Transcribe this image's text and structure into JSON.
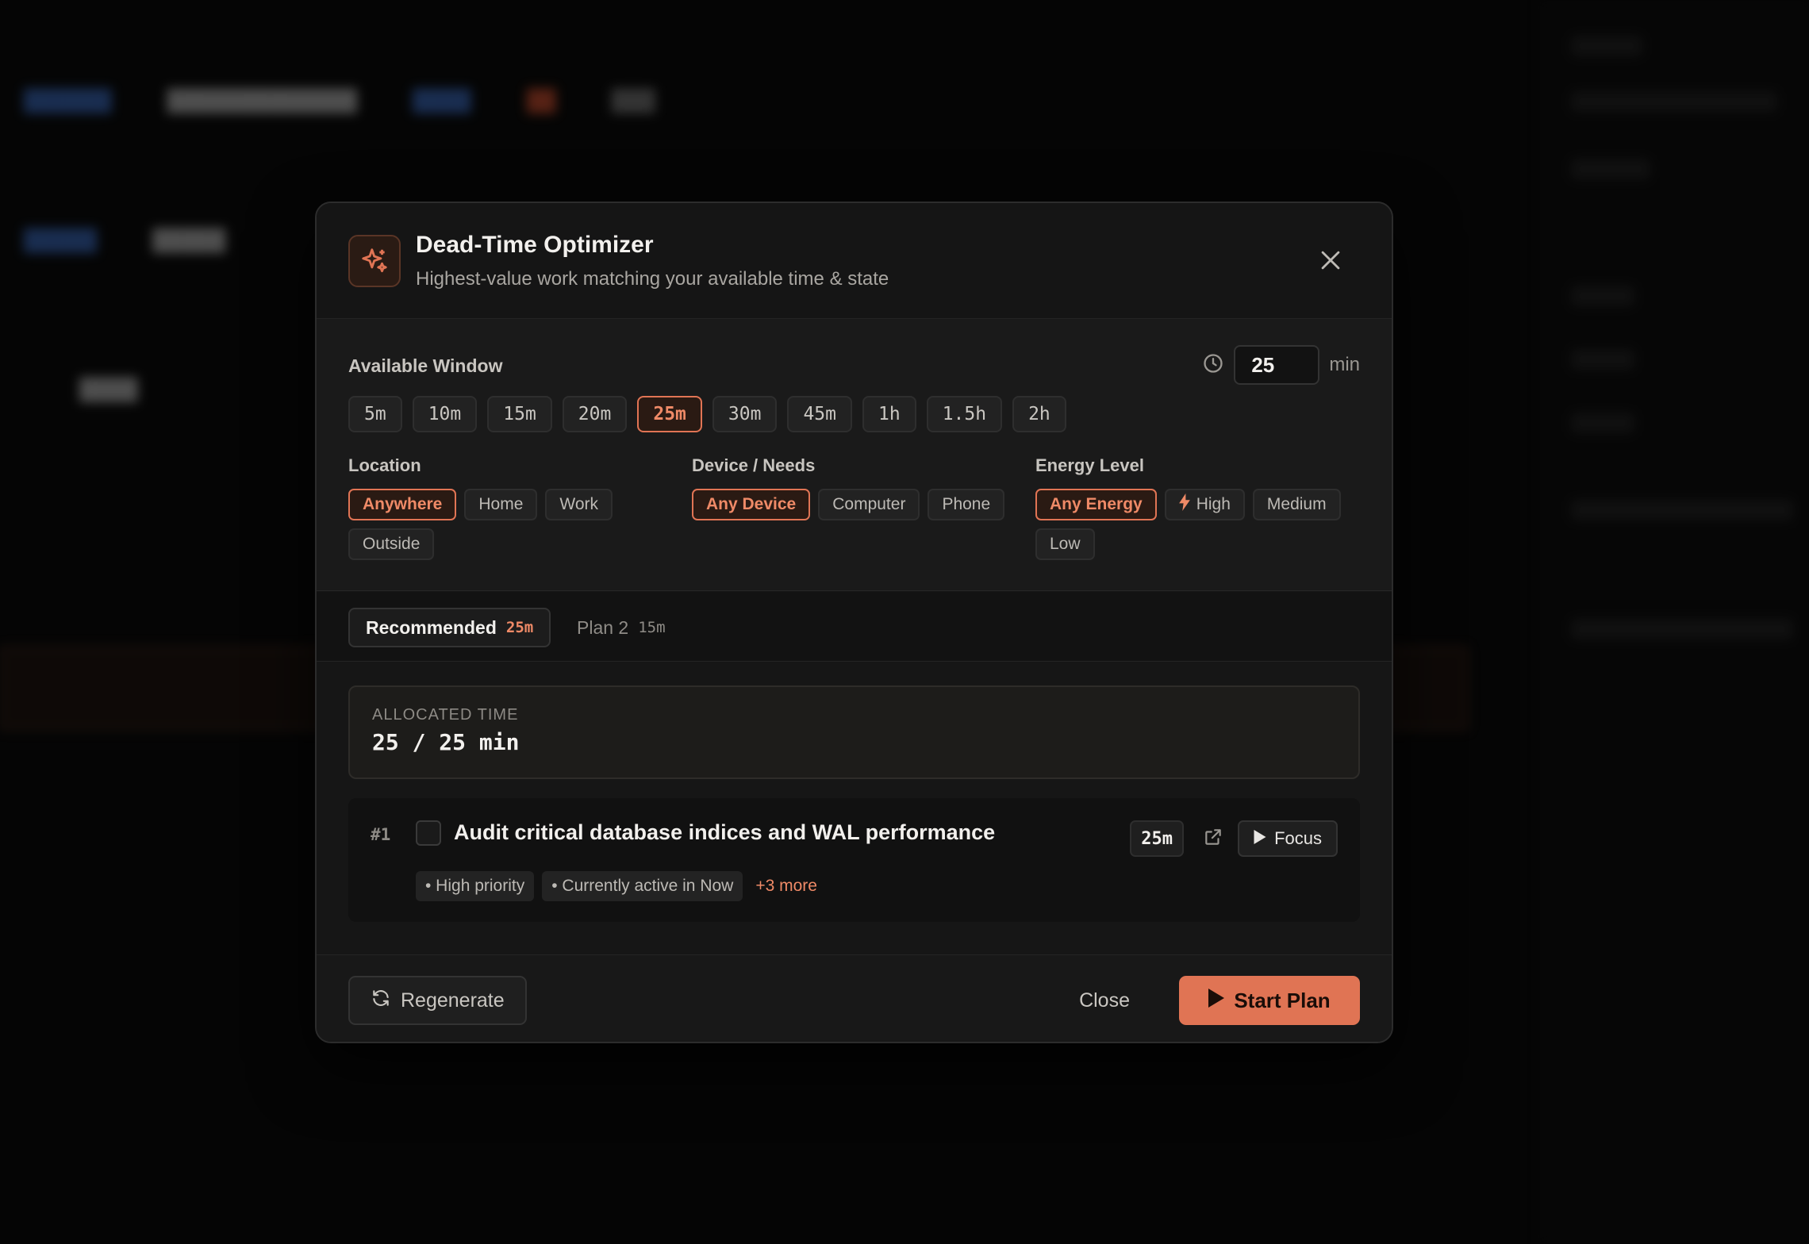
{
  "dialog": {
    "title": "Dead-Time Optimizer",
    "subtitle": "Highest-value work matching your available time & state",
    "header_icon": "sparkle-icon",
    "close_icon": "close-icon"
  },
  "window": {
    "label": "Available Window",
    "clock_icon": "clock-icon",
    "minutes_value": "25",
    "unit": "min",
    "options": [
      "5m",
      "10m",
      "15m",
      "20m",
      "25m",
      "30m",
      "45m",
      "1h",
      "1.5h",
      "2h"
    ],
    "selected": "25m"
  },
  "location": {
    "label": "Location",
    "options": [
      "Anywhere",
      "Home",
      "Work",
      "Outside"
    ],
    "selected": "Anywhere"
  },
  "device": {
    "label": "Device / Needs",
    "options": [
      "Any Device",
      "Computer",
      "Phone"
    ],
    "selected": "Any Device"
  },
  "energy": {
    "label": "Energy Level",
    "options": [
      "Any Energy",
      "High",
      "Medium",
      "Low"
    ],
    "selected": "Any Energy",
    "high_icon": "lightning-icon"
  },
  "tabs": [
    {
      "label": "Recommended",
      "duration": "25m",
      "active": true
    },
    {
      "label": "Plan 2",
      "duration": "15m",
      "active": false
    }
  ],
  "allocated": {
    "label": "ALLOCATED TIME",
    "value": "25 / 25 min"
  },
  "task": {
    "rank": "#1",
    "title": "Audit critical database indices and WAL performance",
    "duration": "25m",
    "tags": [
      "• High priority",
      "• Currently active in Now"
    ],
    "more": "+3 more",
    "focus_label": "Focus",
    "external_icon": "external-link-icon",
    "play_icon": "play-icon"
  },
  "footer": {
    "regenerate_label": "Regenerate",
    "regenerate_icon": "refresh-icon",
    "close_label": "Close",
    "start_label": "Start Plan",
    "start_icon": "play-icon"
  },
  "colors": {
    "accent": "#e07454",
    "background": "#050505",
    "dialog": "#161616"
  }
}
